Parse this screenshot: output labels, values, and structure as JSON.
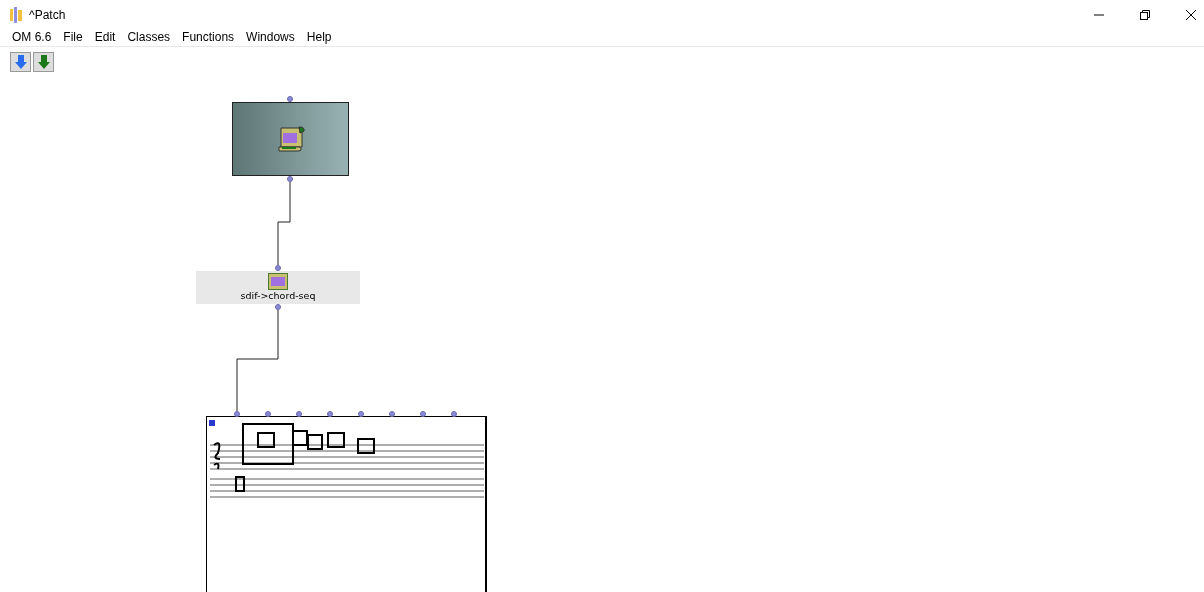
{
  "window": {
    "title": "^Patch"
  },
  "menu": [
    "OM 6.6",
    "File",
    "Edit",
    "Classes",
    "Functions",
    "Windows",
    "Help"
  ],
  "toolbar": [
    {
      "kind": "blue-down"
    },
    {
      "kind": "green-down"
    }
  ],
  "boxes": [
    {
      "kind": "sdif-file"
    },
    {
      "kind": "function",
      "label": "sdif->chord-seq"
    },
    {
      "kind": "score"
    }
  ]
}
